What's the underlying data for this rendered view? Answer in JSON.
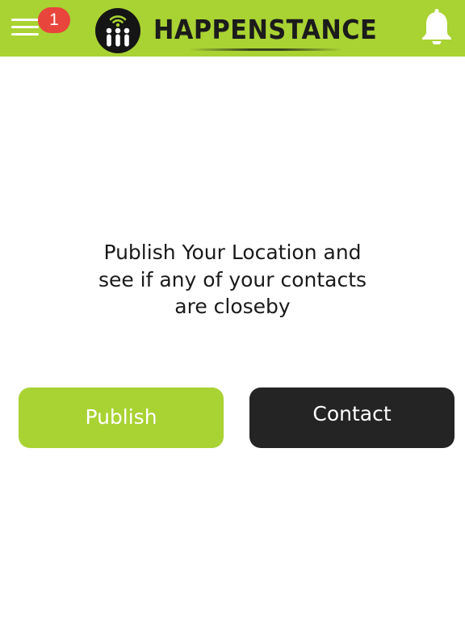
{
  "header": {
    "notification_count": "1",
    "logo_text": "HAPPENSTANCE",
    "menu_icon": "hamburger-menu-icon",
    "bell_icon": "bell-icon"
  },
  "main": {
    "message_lines": [
      "Publish Your Location and",
      "see if any of your contacts",
      "are closeby"
    ],
    "publish_label": "Publish",
    "contact_label": "Contact"
  },
  "colors": {
    "brand_green": "#a9d233",
    "dark_button": "#242424",
    "badge_red": "#e8453c",
    "text": "#1a1a1a"
  }
}
